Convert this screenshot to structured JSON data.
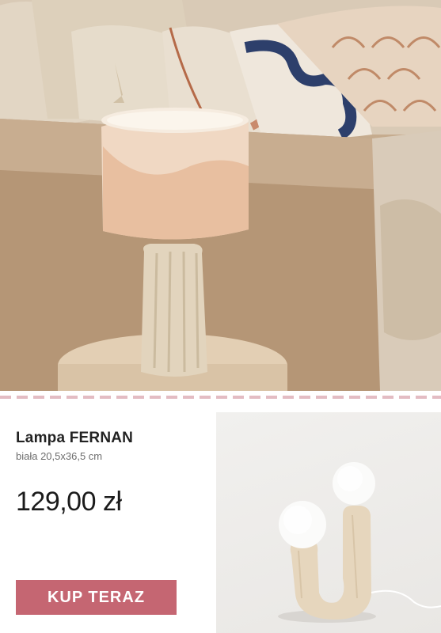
{
  "product": {
    "name": "Lampa FERNAN",
    "description": "biała 20,5x36,5 cm",
    "price": "129,00 zł"
  },
  "cta": {
    "label": "KUP TERAZ"
  },
  "colors": {
    "accent": "#c56672",
    "divider": "#e3bcc3",
    "text": "#222222",
    "muted": "#6e6e6e"
  }
}
